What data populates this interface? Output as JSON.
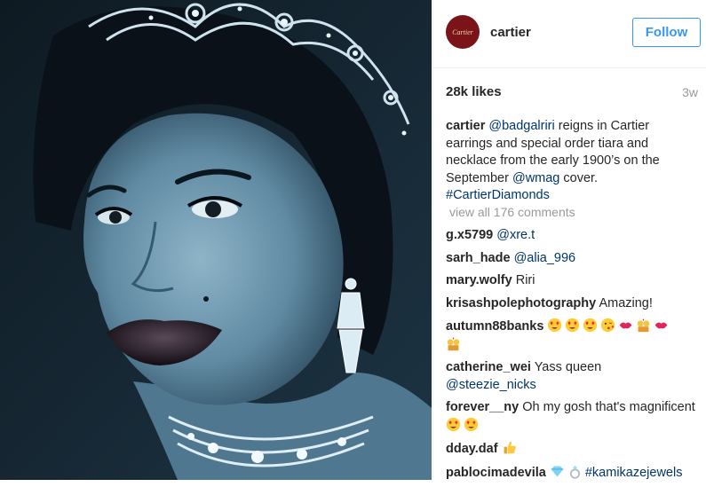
{
  "post": {
    "image_alt": "Portrait of woman wearing diamond tiara, earrings and necklace",
    "account": {
      "username": "cartier",
      "avatar_text": "Cartier"
    },
    "follow_label": "Follow",
    "likes": "28k likes",
    "time_ago": "3w",
    "caption": {
      "username": "cartier",
      "mention1": "@badgalriri",
      "text1": " reigns in Cartier earrings and special order tiara and necklace from the early 1900’s on the September ",
      "mention2": "@wmag",
      "text2": " cover. ",
      "hashtag": "#CartierDiamonds"
    },
    "view_all": "view all 176 comments",
    "comments": [
      {
        "user": "g.x5799",
        "link": "@xre.t",
        "text": ""
      },
      {
        "user": "sarh_hade",
        "link": "@alia_996",
        "text": ""
      },
      {
        "user": "mary.wolfy",
        "link": "",
        "text": "Riri"
      },
      {
        "user": "krisashpolephotography",
        "link": "",
        "text": "Amazing!"
      },
      {
        "user": "autumn88banks",
        "link": "",
        "text": ""
      },
      {
        "user": "catherine_wei",
        "link": "@steezie_nicks",
        "text": "Yass queen"
      },
      {
        "user": "forever__ny",
        "link": "",
        "text": "Oh my gosh that's magnificent"
      },
      {
        "user": "dday.daf",
        "link": "",
        "text": ""
      },
      {
        "user": "pablocimadevila",
        "link": "#kamikazejewels",
        "text": ""
      }
    ]
  },
  "colors": {
    "accent": "#3897f0",
    "link": "#003569",
    "muted": "#999999"
  }
}
